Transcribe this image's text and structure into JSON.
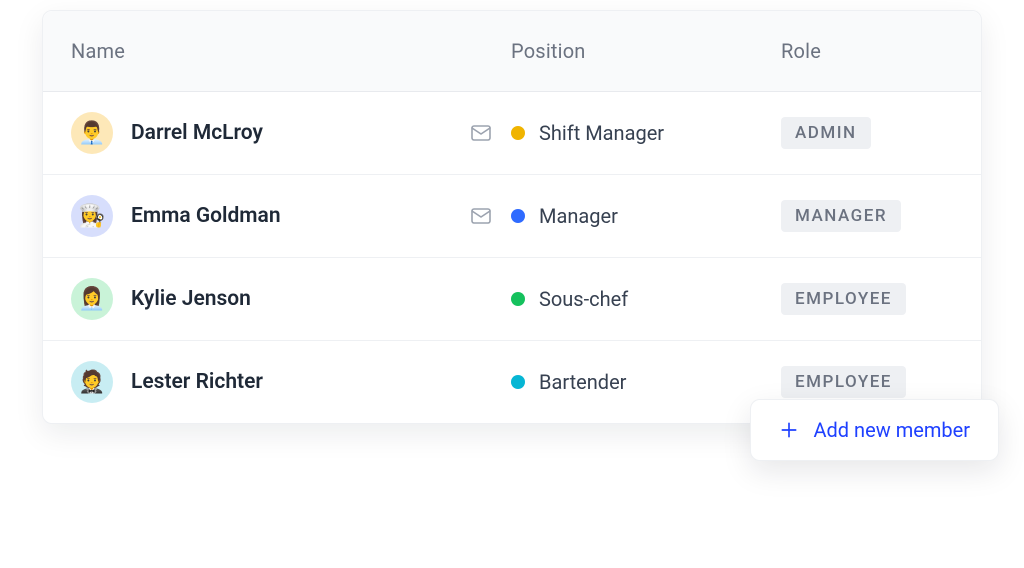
{
  "columns": {
    "name": "Name",
    "position": "Position",
    "role": "Role"
  },
  "members": [
    {
      "name": "Darrel McLroy",
      "avatar_emoji": "👨‍💼",
      "avatar_bg": "#fde8b8",
      "has_mail": true,
      "position": "Shift Manager",
      "dot_color": "#f0b400",
      "role": "ADMIN"
    },
    {
      "name": "Emma Goldman",
      "avatar_emoji": "👩‍🍳",
      "avatar_bg": "#d7defc",
      "has_mail": true,
      "position": "Manager",
      "dot_color": "#2f6bff",
      "role": "MANAGER"
    },
    {
      "name": "Kylie Jenson",
      "avatar_emoji": "👩‍💼",
      "avatar_bg": "#c9f3d8",
      "has_mail": false,
      "position": "Sous-chef",
      "dot_color": "#15c15d",
      "role": "EMPLOYEE"
    },
    {
      "name": "Lester Richter",
      "avatar_emoji": "🤵",
      "avatar_bg": "#c8edf3",
      "has_mail": false,
      "position": "Bartender",
      "dot_color": "#06b6d4",
      "role": "EMPLOYEE"
    }
  ],
  "add_button": {
    "label": "Add new member"
  }
}
